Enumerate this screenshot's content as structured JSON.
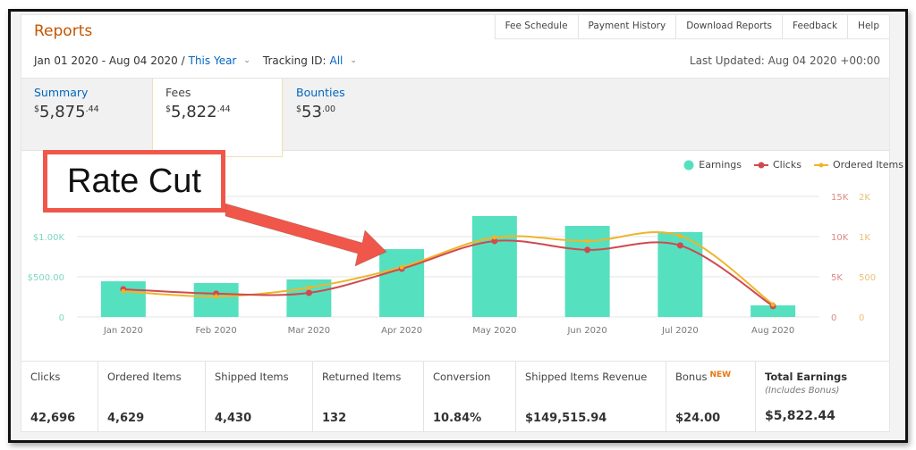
{
  "header": {
    "title": "Reports",
    "nav": [
      "Fee Schedule",
      "Payment History",
      "Download Reports",
      "Feedback",
      "Help"
    ],
    "date_range": "Jan 01 2020 - Aug 04 2020 /",
    "date_preset": "This Year",
    "tracking_label": "Tracking ID:",
    "tracking_value": "All",
    "last_updated": "Last Updated: Aug 04 2020 +00:00"
  },
  "tabs": [
    {
      "label": "Summary",
      "currency": "$",
      "whole": "5,875",
      "cents": ".44",
      "active": false
    },
    {
      "label": "Fees",
      "currency": "$",
      "whole": "5,822",
      "cents": ".44",
      "active": true
    },
    {
      "label": "Bounties",
      "currency": "$",
      "whole": "53",
      "cents": ".00",
      "active": false
    }
  ],
  "annotation": {
    "text": "Rate Cut",
    "color": "#f0574a"
  },
  "legend": {
    "earnings": "Earnings",
    "clicks": "Clicks",
    "ordered": "Ordered Items"
  },
  "colors": {
    "earnings": "#55e0c0",
    "clicks": "#cf4a4f",
    "ordered": "#f0b429",
    "title": "#c45500",
    "link": "#0066c0"
  },
  "chart_data": {
    "type": "bar",
    "title": "",
    "categories": [
      "Jan 2020",
      "Feb 2020",
      "Mar 2020",
      "Apr 2020",
      "May 2020",
      "Jun 2020",
      "Jul 2020",
      "Aug 2020"
    ],
    "series": [
      {
        "name": "Earnings",
        "type": "bar",
        "axis": "left",
        "values": [
          444,
          422,
          467,
          844,
          1256,
          1133,
          1056,
          144
        ]
      },
      {
        "name": "Clicks",
        "type": "line",
        "axis": "right1",
        "values": [
          3450,
          2900,
          3000,
          6000,
          9450,
          8350,
          8900,
          1350
        ]
      },
      {
        "name": "Ordered Items",
        "type": "line",
        "axis": "right2",
        "values": [
          320,
          255,
          365,
          620,
          990,
          945,
          1010,
          155
        ]
      }
    ],
    "left_axis": {
      "ticks": [
        "0",
        "$500.00",
        "$1.00K",
        "$"
      ],
      "range": [
        0,
        1500
      ]
    },
    "right1_axis": {
      "ticks": [
        "0",
        "5K",
        "10K",
        "15K"
      ],
      "range": [
        0,
        15000
      ]
    },
    "right2_axis": {
      "ticks": [
        "0",
        "500",
        "1K",
        "2K"
      ],
      "range": [
        0,
        1500
      ]
    },
    "grid": true,
    "legend_position": "top-right"
  },
  "stats": [
    {
      "label": "Clicks",
      "value": "42,696"
    },
    {
      "label": "Ordered Items",
      "value": "4,629"
    },
    {
      "label": "Shipped Items",
      "value": "4,430"
    },
    {
      "label": "Returned Items",
      "value": "132"
    },
    {
      "label": "Conversion",
      "value": "10.84%"
    },
    {
      "label": "Shipped Items Revenue",
      "value": "$149,515.94"
    },
    {
      "label": "Bonus",
      "badge": "NEW",
      "value": "$24.00"
    },
    {
      "label": "Total Earnings",
      "sub": "(Includes Bonus)",
      "value": "$5,822.44"
    }
  ]
}
